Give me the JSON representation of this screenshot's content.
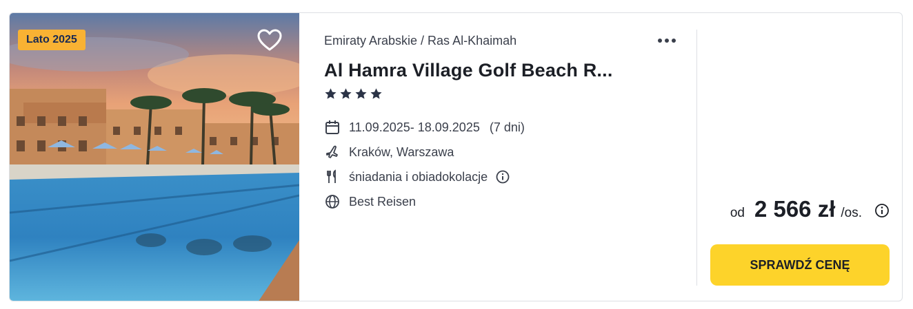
{
  "badge": "Lato 2025",
  "location": "Emiraty Arabskie / Ras Al-Khaimah",
  "title": "Al Hamra Village Golf Beach R...",
  "stars": 4,
  "dates": "11.09.2025- 18.09.2025",
  "duration": "(7 dni)",
  "departure": "Kraków, Warszawa",
  "board": "śniadania i obiadokolacje",
  "operator": "Best Reisen",
  "price": {
    "prefix": "od",
    "amount": "2 566 zł",
    "suffix": "/os."
  },
  "cta": "SPRAWDŹ CENĘ",
  "colors": {
    "accent": "#fdd32a",
    "badge": "#f9b233"
  }
}
